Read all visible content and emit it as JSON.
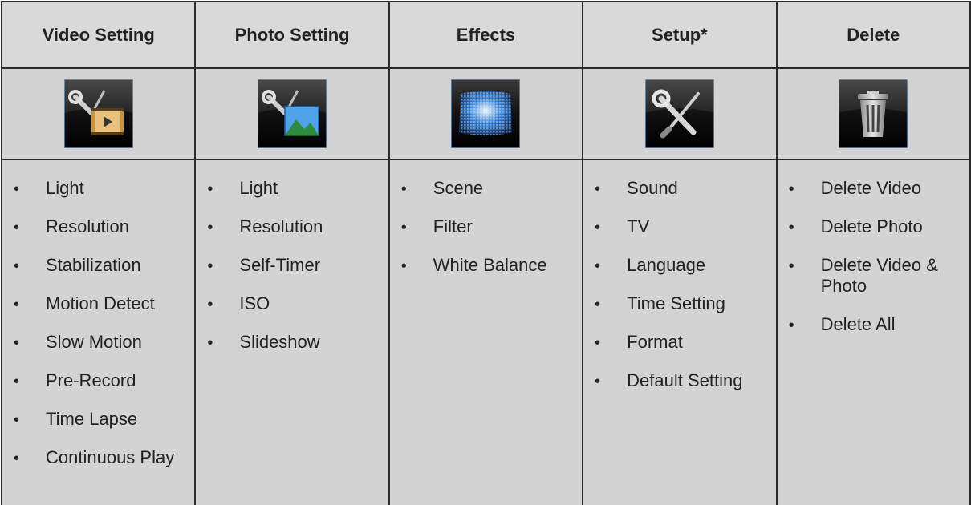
{
  "columns": [
    {
      "title": "Video Setting",
      "icon": "video-setting-icon",
      "items": [
        "Light",
        "Resolution",
        "Stabilization",
        "Motion Detect",
        "Slow Motion",
        "Pre-Record",
        "Time Lapse",
        "Continuous Play"
      ]
    },
    {
      "title": "Photo Setting",
      "icon": "photo-setting-icon",
      "items": [
        "Light",
        "Resolution",
        "Self-Timer",
        "ISO",
        "Slideshow"
      ]
    },
    {
      "title": "Effects",
      "icon": "effects-icon",
      "items": [
        "Scene",
        "Filter",
        "White Balance"
      ]
    },
    {
      "title": "Setup*",
      "icon": "setup-icon",
      "items": [
        "Sound",
        "TV",
        "Language",
        "Time Setting",
        "Format",
        "Default Setting"
      ]
    },
    {
      "title": "Delete",
      "icon": "trash-icon",
      "items": [
        "Delete Video",
        "Delete Photo",
        "Delete Video & Photo",
        "Delete All"
      ]
    }
  ],
  "colors": {
    "cell_background": "#d3d3d3",
    "border": "#2b2b2b",
    "icon_accent_blue": "#2f7fd8"
  }
}
